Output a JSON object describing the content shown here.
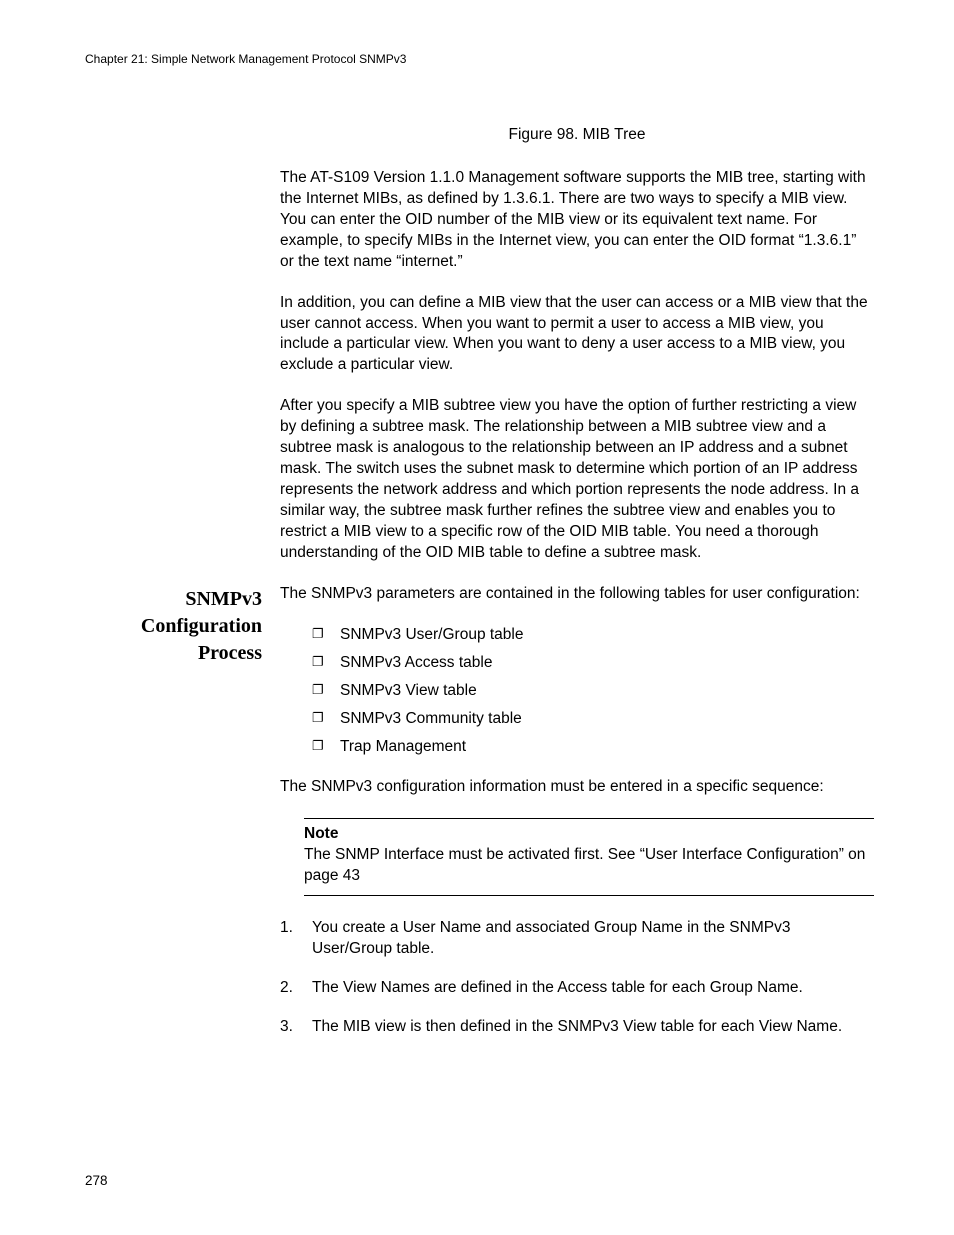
{
  "header": {
    "running": "Chapter 21: Simple Network Management Protocol SNMPv3"
  },
  "figure_caption": "Figure 98. MIB Tree",
  "intro": {
    "p1": "The AT-S109 Version 1.1.0  Management software supports the MIB tree, starting with the Internet MIBs, as defined by 1.3.6.1. There are two ways to specify a MIB view. You can enter the OID number of the MIB view or its equivalent text name. For example, to specify MIBs in the Internet view, you can enter the OID format “1.3.6.1” or the text name “internet.”",
    "p2": "In addition, you can define a MIB view that the user can access or a MIB view that the user cannot access. When you want to permit a user to access a MIB view, you include a particular view. When you want to deny a user access to a MIB view, you exclude a particular view.",
    "p3": "After you specify a MIB subtree view you have the option of further restricting a view by defining a subtree mask. The relationship between a MIB subtree view and a subtree mask is analogous to the relationship between an IP address and a subnet mask. The switch uses the subnet mask to determine which portion of an IP address represents the network address and which portion represents the node address. In a similar way, the subtree mask further refines the subtree view and enables you to restrict a MIB view to a specific row of the OID MIB table. You need a thorough understanding of the OID MIB table to define a subtree mask."
  },
  "section": {
    "heading": "SNMPv3 Configuration Process",
    "lead": "The SNMPv3 parameters are contained in the following tables for user configuration:",
    "bullets": [
      "SNMPv3 User/Group table",
      "SNMPv3 Access table",
      "SNMPv3 View table",
      "SNMPv3 Community table",
      "Trap Management"
    ],
    "seq_intro": "The SNMPv3 configuration information must be entered in a specific sequence:",
    "note": {
      "label": "Note",
      "text": "The SNMP Interface must be activated first. See “User Interface Configuration” on page 43"
    },
    "steps": [
      "You create a User Name and associated Group Name in the SNMPv3 User/Group table.",
      "The View Names are defined in the Access table for each Group Name.",
      "The MIB view is then defined in the SNMPv3 View table for each View Name."
    ]
  },
  "page_number": "278"
}
